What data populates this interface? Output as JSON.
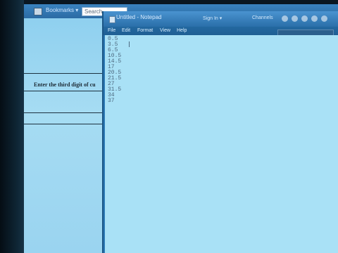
{
  "browser": {
    "bookmarks_label": "Bookmarks ▾",
    "search_placeholder": "Search",
    "toolbar_labels": [
      "Sign In ▾",
      "Channels"
    ]
  },
  "page": {
    "prompt_text": "Enter the third digit of cu"
  },
  "notepad": {
    "title": "Untitled - Notepad",
    "menu": [
      "File",
      "Edit",
      "Format",
      "View",
      "Help"
    ],
    "lines": [
      "0.5",
      "3.5",
      "6.5",
      "10.5",
      "14.5",
      "17",
      "20.5",
      "21.5",
      "27",
      "31.5",
      "34",
      "37"
    ]
  }
}
